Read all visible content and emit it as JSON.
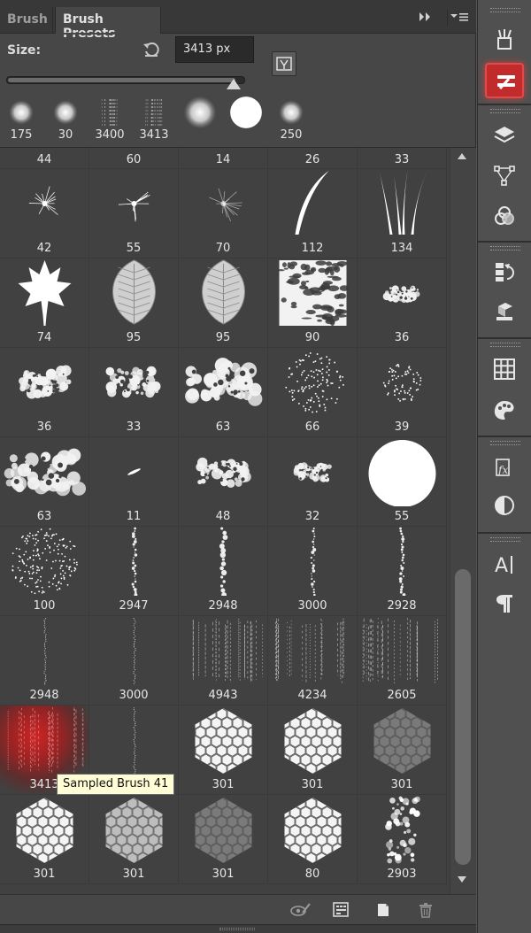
{
  "tabs": [
    {
      "label": "Brush",
      "active": false
    },
    {
      "label": "Brush Presets",
      "active": true
    }
  ],
  "panel_controls": {
    "collapse_icon": "double-chevron-right-icon",
    "menu_icon": "panel-menu-icon"
  },
  "size": {
    "label": "Size:",
    "value": "3413 px",
    "slider_fraction": 0.96
  },
  "recent_brushes": [
    {
      "label": "175",
      "shape": "soft"
    },
    {
      "label": "30",
      "shape": "soft"
    },
    {
      "label": "3400",
      "shape": "streak"
    },
    {
      "label": "3413",
      "shape": "streak"
    },
    {
      "label": "",
      "shape": "soft-large"
    },
    {
      "label": "",
      "shape": "hard-large"
    },
    {
      "label": "250",
      "shape": "soft"
    }
  ],
  "grid_top_labels": [
    "44",
    "60",
    "14",
    "26",
    "33"
  ],
  "brushes": [
    {
      "label": "42",
      "shape": "star"
    },
    {
      "label": "55",
      "shape": "star"
    },
    {
      "label": "70",
      "shape": "star-faint"
    },
    {
      "label": "112",
      "shape": "grass-single"
    },
    {
      "label": "134",
      "shape": "grass-multi"
    },
    {
      "label": "74",
      "shape": "maple-leaf"
    },
    {
      "label": "95",
      "shape": "leaf"
    },
    {
      "label": "95",
      "shape": "leaf"
    },
    {
      "label": "90",
      "shape": "texture-square"
    },
    {
      "label": "36",
      "shape": "splotch-small"
    },
    {
      "label": "36",
      "shape": "splotch"
    },
    {
      "label": "33",
      "shape": "splotch"
    },
    {
      "label": "63",
      "shape": "splotch-large"
    },
    {
      "label": "66",
      "shape": "scatter"
    },
    {
      "label": "39",
      "shape": "scatter-small"
    },
    {
      "label": "63",
      "shape": "splotch-large"
    },
    {
      "label": "11",
      "shape": "dash"
    },
    {
      "label": "48",
      "shape": "splotch"
    },
    {
      "label": "32",
      "shape": "splotch-small"
    },
    {
      "label": "55",
      "shape": "hard-circle"
    },
    {
      "label": "100",
      "shape": "dot-sphere"
    },
    {
      "label": "2947",
      "shape": "dotted-line"
    },
    {
      "label": "2948",
      "shape": "beaded-line"
    },
    {
      "label": "3000",
      "shape": "dotted-line"
    },
    {
      "label": "2928",
      "shape": "dotted-line"
    },
    {
      "label": "2948",
      "shape": "thin-line"
    },
    {
      "label": "3000",
      "shape": "thin-line"
    },
    {
      "label": "4943",
      "shape": "streaks"
    },
    {
      "label": "4234",
      "shape": "streaks"
    },
    {
      "label": "2605",
      "shape": "streaks"
    },
    {
      "label": "3413",
      "shape": "streaks-red",
      "selected": true
    },
    {
      "label": "",
      "shape": "thin-line"
    },
    {
      "label": "301",
      "shape": "hexagon-light"
    },
    {
      "label": "301",
      "shape": "hexagon-light"
    },
    {
      "label": "301",
      "shape": "hexagon-dark"
    },
    {
      "label": "301",
      "shape": "hexagon-light"
    },
    {
      "label": "301",
      "shape": "hexagon-mid"
    },
    {
      "label": "301",
      "shape": "hexagon-dark"
    },
    {
      "label": "80",
      "shape": "hexagon-light"
    },
    {
      "label": "2903",
      "shape": "bokeh-dots"
    }
  ],
  "tooltip": "Sampled Brush 41",
  "bottom_toolbar": [
    {
      "name": "toggle-brush-panel-icon"
    },
    {
      "name": "open-preset-manager-icon"
    },
    {
      "name": "create-new-brush-icon"
    },
    {
      "name": "delete-brush-icon"
    }
  ],
  "dock": [
    {
      "name": "brushes-icon"
    },
    {
      "name": "brush-presets-icon",
      "active": true
    },
    {
      "name": "layers-icon"
    },
    {
      "name": "paths-icon"
    },
    {
      "name": "channels-icon"
    },
    {
      "name": "history-icon"
    },
    {
      "name": "properties-icon"
    },
    {
      "name": "swatches-icon"
    },
    {
      "name": "color-icon"
    },
    {
      "name": "styles-icon"
    },
    {
      "name": "adjustments-icon"
    },
    {
      "name": "character-icon"
    },
    {
      "name": "paragraph-icon"
    }
  ],
  "colors": {
    "selected_glow": "#c22b2b",
    "tooltip_bg": "#fefdd5",
    "panel_bg": "#474747"
  }
}
